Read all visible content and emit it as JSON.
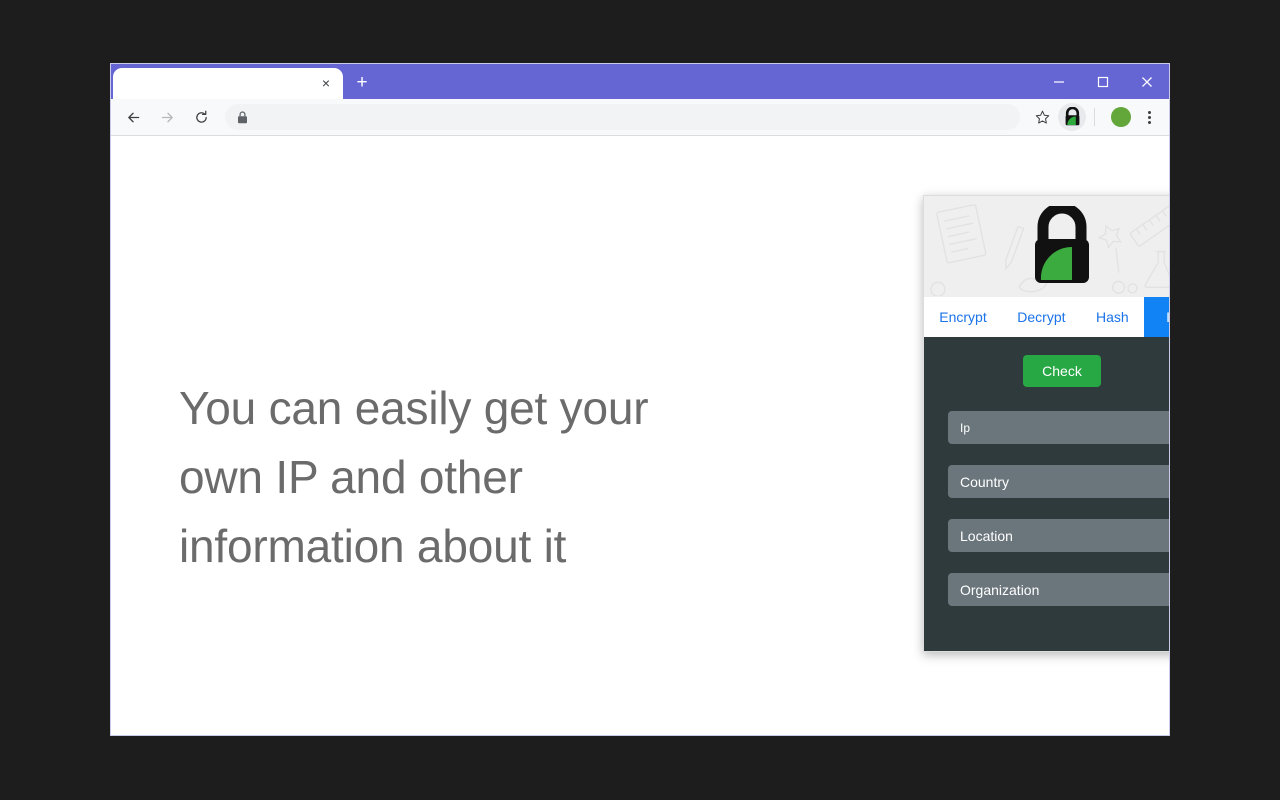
{
  "browser": {
    "tab": {
      "title": "",
      "close_label": "×"
    },
    "new_tab_label": "+",
    "window_controls": {
      "minimize": "─",
      "maximize": "☐",
      "close": "✕"
    },
    "toolbar": {
      "back_icon": "back-arrow-icon",
      "forward_icon": "forward-arrow-icon",
      "reload_icon": "reload-icon",
      "url_value": "",
      "url_placeholder": "",
      "site_lock_icon": "lock-icon",
      "bookmark_icon": "star-icon",
      "extension_icon": "lock-extension-icon",
      "profile_icon": "profile-avatar",
      "menu_icon": "three-dot-menu-icon"
    }
  },
  "page": {
    "heading": "You can easily get your own IP and other information about it"
  },
  "popup": {
    "logo_icon": "green-lock-logo",
    "tabs": [
      {
        "label": "Encrypt",
        "active": false
      },
      {
        "label": "Decrypt",
        "active": false
      },
      {
        "label": "Hash",
        "active": false
      },
      {
        "label": "Ip",
        "active": true
      }
    ],
    "check_button": "Check",
    "fields": [
      {
        "name": "ip",
        "placeholder": "Ip",
        "value": ""
      },
      {
        "name": "country",
        "placeholder": "Country",
        "value": ""
      },
      {
        "name": "location",
        "placeholder": "Location",
        "value": ""
      },
      {
        "name": "organization",
        "placeholder": "Organization",
        "value": ""
      }
    ]
  },
  "colors": {
    "tab_strip_purple": "#6566d4",
    "popup_body_dark": "#2f3a3d",
    "field_gray": "#6b767c",
    "check_green": "#28a745",
    "active_tab_blue": "#1283f5",
    "link_blue": "#1a73e8",
    "heading_gray": "#6b6b6b",
    "desktop_background": "#1d1d1d"
  }
}
